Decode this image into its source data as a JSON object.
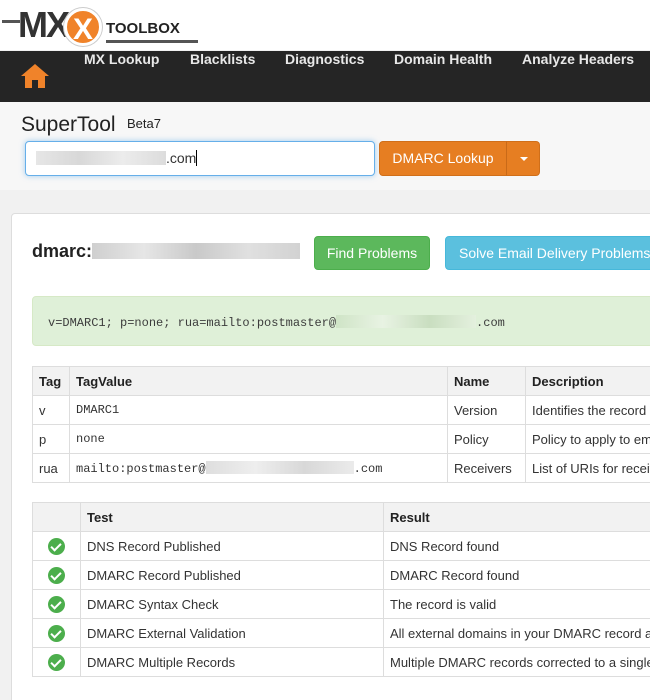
{
  "logo": {
    "text_mx": "MX",
    "text_toolbox": "TOOLBOX"
  },
  "nav": {
    "home_icon": "home-icon",
    "items": [
      "MX Lookup",
      "Blacklists",
      "Diagnostics",
      "Domain Health",
      "Analyze Headers"
    ]
  },
  "tool": {
    "title": "SuperTool",
    "beta": "Beta7",
    "input_suffix": ".com",
    "lookup_label": "DMARC Lookup"
  },
  "result": {
    "heading_prefix": "dmarc:",
    "find_label": "Find Problems",
    "solve_label": "Solve Email Delivery Problems",
    "record_prefix": "v=DMARC1; p=none; rua=mailto:postmaster@",
    "record_suffix": ".com"
  },
  "tag_table": {
    "headers": [
      "Tag",
      "TagValue",
      "Name",
      "Description"
    ],
    "rows": [
      {
        "tag": "v",
        "value": "DMARC1",
        "name": "Version",
        "desc": "Identifies the record r"
      },
      {
        "tag": "p",
        "value": "none",
        "name": "Policy",
        "desc": "Policy to apply to em"
      },
      {
        "tag": "rua",
        "value_prefix": "mailto:postmaster@",
        "value_suffix": ".com",
        "name": "Receivers",
        "desc": "List of URIs for receiv"
      }
    ]
  },
  "test_table": {
    "headers": [
      "",
      "Test",
      "Result"
    ],
    "rows": [
      {
        "status": "check-icon",
        "test": "DNS Record Published",
        "result": "DNS Record found"
      },
      {
        "status": "check-icon",
        "test": "DMARC Record Published",
        "result": "DMARC Record found"
      },
      {
        "status": "check-icon",
        "test": "DMARC Syntax Check",
        "result": "The record is valid"
      },
      {
        "status": "check-icon",
        "test": "DMARC External Validation",
        "result": "All external domains in your DMARC record a"
      },
      {
        "status": "check-icon",
        "test": "DMARC Multiple Records",
        "result": "Multiple DMARC records corrected to a single"
      }
    ]
  },
  "colors": {
    "nav_bg": "#252525",
    "accent": "#e67e22",
    "success": "#5cb85c",
    "info": "#5bc0de",
    "record_bg": "#dff0d8"
  }
}
